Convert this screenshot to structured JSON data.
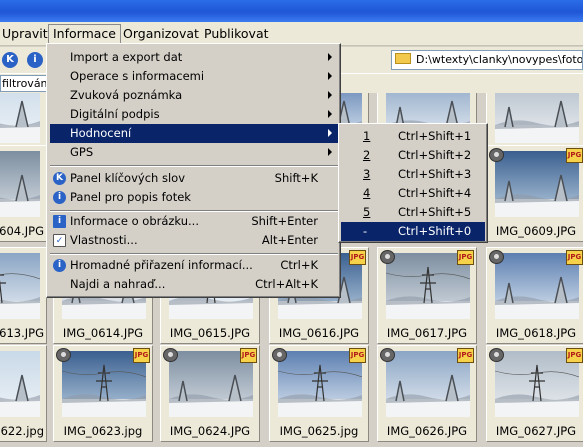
{
  "menubar": {
    "items": [
      "Upravit",
      "Informace",
      "Organizovat",
      "Publikovat"
    ],
    "active": "Informace"
  },
  "toolbar": {
    "path": "D:\\wtexty\\clanky\\novypes\\fototeu",
    "filter": "filtrování..."
  },
  "menu": {
    "items": [
      {
        "label": "Import a export dat",
        "shortcut": "",
        "arrow": true
      },
      {
        "label": "Operace s informacemi",
        "shortcut": "",
        "arrow": true
      },
      {
        "label": "Zvuková poznámka",
        "shortcut": "",
        "arrow": true
      },
      {
        "label": "Digitální podpis",
        "shortcut": "",
        "arrow": true
      },
      {
        "label": "Hodnocení",
        "shortcut": "",
        "arrow": true,
        "selected": true
      },
      {
        "label": "GPS",
        "shortcut": "",
        "arrow": true
      },
      {
        "label": "Panel klíčových slov",
        "shortcut": "Shift+K",
        "icon": "k-circle-icon"
      },
      {
        "label": "Panel pro popis fotek",
        "shortcut": "",
        "icon": "info-circle-icon"
      },
      {
        "label": "Informace o obrázku...",
        "shortcut": "Shift+Enter",
        "icon": "info-square-icon"
      },
      {
        "label": "Vlastnosti...",
        "shortcut": "Alt+Enter",
        "icon": "properties-icon"
      },
      {
        "label": "Hromadné přiřazení informací...",
        "shortcut": "Ctrl+K",
        "icon": "info-circle-icon"
      },
      {
        "label": "Najdi a nahraď...",
        "shortcut": "Ctrl+Alt+K"
      }
    ]
  },
  "submenu": {
    "items": [
      {
        "key": "1",
        "shortcut": "Ctrl+Shift+1"
      },
      {
        "key": "2",
        "shortcut": "Ctrl+Shift+2"
      },
      {
        "key": "3",
        "shortcut": "Ctrl+Shift+3"
      },
      {
        "key": "4",
        "shortcut": "Ctrl+Shift+4"
      },
      {
        "key": "5",
        "shortcut": "Ctrl+Shift+5"
      },
      {
        "key": "-",
        "shortcut": "Ctrl+Shift+0",
        "selected": true
      }
    ]
  },
  "thumbnails": {
    "badge": "JPG",
    "rows": [
      [
        "0597.JPG",
        "",
        "",
        "",
        "IMG_0600.JPG",
        "IMG_0601.JPG"
      ],
      [
        "0604.JPG",
        "",
        "",
        "",
        "",
        "IMG_0609.JPG"
      ],
      [
        "0613.JPG",
        "IMG_0614.JPG",
        "IMG_0615.JPG",
        "IMG_0616.JPG",
        "IMG_0617.JPG",
        "IMG_0618.JPG"
      ],
      [
        "0622.jpg",
        "IMG_0623.jpg",
        "IMG_0624.JPG",
        "IMG_0625.jpg",
        "IMG_0626.JPG",
        "IMG_0627.JPG"
      ]
    ]
  }
}
